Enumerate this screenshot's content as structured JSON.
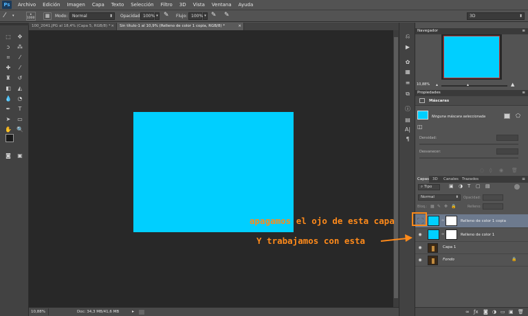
{
  "app_logo": "Ps",
  "menu": [
    "Archivo",
    "Edición",
    "Imagen",
    "Capa",
    "Texto",
    "Selección",
    "Filtro",
    "3D",
    "Vista",
    "Ventana",
    "Ayuda"
  ],
  "options": {
    "brush_size": "1000",
    "mode_label": "Modo:",
    "mode_value": "Normal",
    "opacity_label": "Opacidad:",
    "opacity_value": "100%",
    "flow_label": "Flujo:",
    "flow_value": "100%",
    "workspace_value": "3D"
  },
  "doc_tabs": [
    "100_2041.JPG al 18,4% (Capa 5, RGB/8) *",
    "Sin título-1 al 10,9% (Relleno de color 1 copia, RGB/8) *"
  ],
  "status": {
    "zoom": "10,88%",
    "doc_info": "Doc: 34,3 MB/41,6 MB"
  },
  "navigator": {
    "title": "Navegador",
    "zoom": "10,88%"
  },
  "properties": {
    "title": "Propiedades",
    "section": "Máscaras",
    "no_mask": "Ninguna máscara seleccionada",
    "density_label": "Densidad:",
    "feather_label": "Desvanecer:"
  },
  "layers_panel": {
    "tabs": [
      "Capas",
      "3D",
      "Canales",
      "Trazados"
    ],
    "filter_kind": "Tipo",
    "blend_mode": "Normal",
    "opacity_label": "Opacidad:",
    "lock_label": "Bloq.:",
    "fill_label": "Relleno:",
    "layers": [
      {
        "name": "Relleno de color 1 copia",
        "selected": true,
        "visible": false,
        "type": "fill",
        "mask": true
      },
      {
        "name": "Relleno de color 1",
        "selected": false,
        "visible": true,
        "type": "fill",
        "mask": true
      },
      {
        "name": "Capa 1",
        "selected": false,
        "visible": true,
        "type": "image",
        "mask": false
      },
      {
        "name": "Fondo",
        "selected": false,
        "visible": true,
        "type": "image",
        "mask": false,
        "italic": true,
        "locked": true
      }
    ]
  },
  "annotations": {
    "line1": "apagamos el ojo de esta capa",
    "line2": "Y trabajamos con esta"
  },
  "colors": {
    "fill_cyan": "#00cfff",
    "annotation_orange": "#ff8a1a",
    "selected_layer": "#6d7a8e",
    "canvas_bg": "#282828"
  }
}
